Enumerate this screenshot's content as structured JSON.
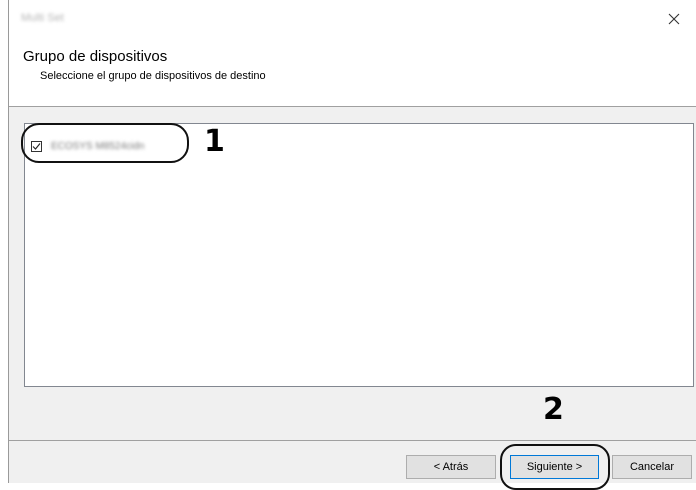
{
  "window": {
    "title": "Multi Set"
  },
  "header": {
    "title": "Grupo de dispositivos",
    "subtitle": "Seleccione el grupo de dispositivos de destino"
  },
  "device_list": {
    "items": [
      {
        "label": "ECOSYS M8524cidn",
        "checked": true
      }
    ]
  },
  "callouts": {
    "step1": "1",
    "step2": "2"
  },
  "buttons": {
    "back": "< Atrás",
    "next": "Siguiente >",
    "cancel": "Cancelar"
  },
  "icons": {
    "close": "close-icon",
    "checkbox": "checkmark-icon"
  },
  "colors": {
    "accent_border": "#0078d7",
    "dialog_background": "#f0f0f0"
  }
}
